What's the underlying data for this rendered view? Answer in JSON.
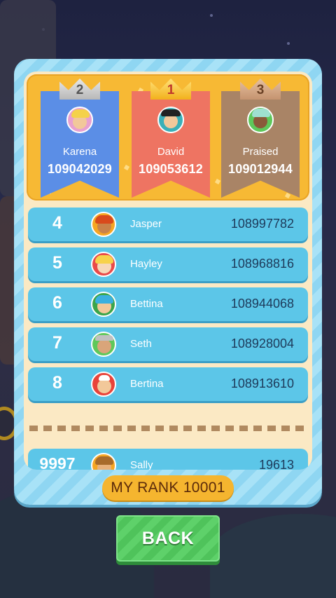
{
  "podium": [
    {
      "rank": "2",
      "name": "Karena",
      "score": "109042029",
      "avatar_icon": "avatar-karena-icon",
      "banner_color": "#5b8ee6"
    },
    {
      "rank": "1",
      "name": "David",
      "score": "109053612",
      "avatar_icon": "avatar-david-icon",
      "banner_color": "#ee7462"
    },
    {
      "rank": "3",
      "name": "Praised",
      "score": "109012944",
      "avatar_icon": "avatar-praised-icon",
      "banner_color": "#a98466"
    }
  ],
  "rows": [
    {
      "rank": "4",
      "name": "Jasper",
      "score": "108997782",
      "avatar_icon": "avatar-jasper-icon"
    },
    {
      "rank": "5",
      "name": "Hayley",
      "score": "108968816",
      "avatar_icon": "avatar-hayley-icon"
    },
    {
      "rank": "6",
      "name": "Bettina",
      "score": "108944068",
      "avatar_icon": "avatar-bettina-icon"
    },
    {
      "rank": "7",
      "name": "Seth",
      "score": "108928004",
      "avatar_icon": "avatar-seth-icon"
    },
    {
      "rank": "8",
      "name": "Bertina",
      "score": "108913610",
      "avatar_icon": "avatar-bertina-icon"
    }
  ],
  "my_row": {
    "rank": "9997",
    "name": "Sally",
    "score": "19613",
    "avatar_icon": "avatar-sally-icon"
  },
  "my_rank_label": "MY RANK 10001",
  "back_label": "BACK",
  "colors": {
    "row": "#5cc6e8",
    "podium": "#f7b934",
    "back": "#4fc35b",
    "my_rank": "#f5b52f"
  }
}
